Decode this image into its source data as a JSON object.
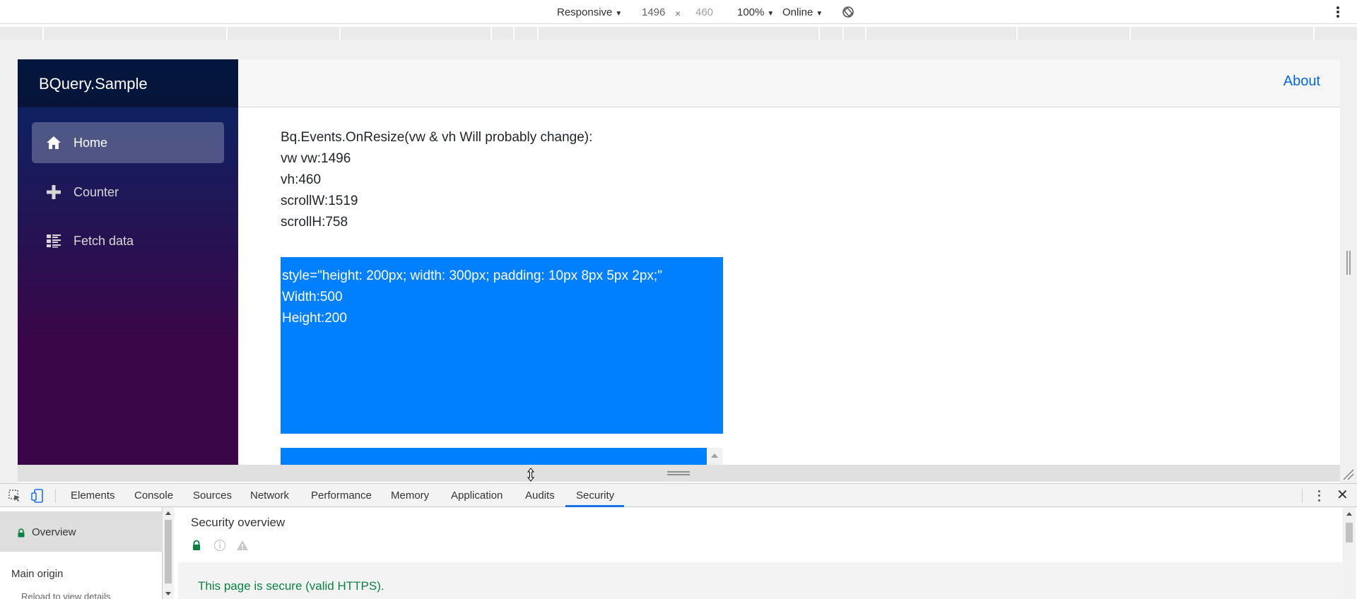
{
  "device_toolbar": {
    "device_mode": "Responsive",
    "width": "1496",
    "dimension_separator": "×",
    "height": "460",
    "zoom": "100%",
    "network": "Online"
  },
  "app": {
    "brand": "BQuery.Sample",
    "nav": [
      {
        "label": "Home",
        "icon": "home-icon",
        "active": true
      },
      {
        "label": "Counter",
        "icon": "plus-icon",
        "active": false
      },
      {
        "label": "Fetch data",
        "icon": "list-icon",
        "active": false
      }
    ],
    "about_link": "About",
    "lines": [
      "Bq.Events.OnResize(vw & vh Will probably change):",
      "vw vw:1496",
      "vh:460",
      "scrollW:1519",
      "scrollH:758"
    ],
    "blue_box": {
      "lines": [
        "style=\"height: 200px; width: 300px; padding: 10px 8px 5px 2px;\"",
        "Width:500",
        "Height:200"
      ]
    }
  },
  "devtools": {
    "tabs": [
      "Elements",
      "Console",
      "Sources",
      "Network",
      "Performance",
      "Memory",
      "Application",
      "Audits",
      "Security"
    ],
    "active_tab": "Security",
    "sidebar": {
      "overview": "Overview",
      "main_origin": "Main origin",
      "reload_details": "Reload to view details"
    },
    "main": {
      "title": "Security overview",
      "secure_message": "This page is secure (valid HTTPS)."
    }
  },
  "colors": {
    "accent_blue": "#0080ff",
    "link": "#0366d6",
    "secure_green": "#0b8043",
    "tab_underline": "#1a73e8"
  }
}
